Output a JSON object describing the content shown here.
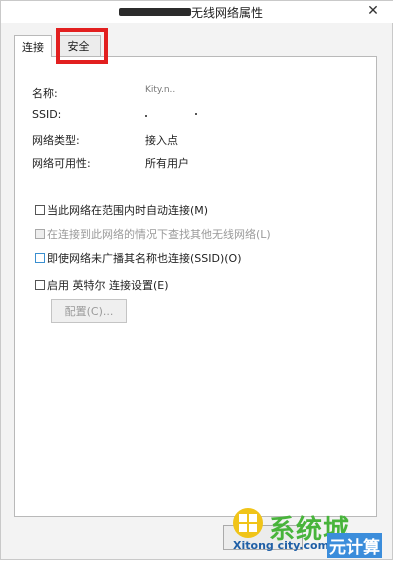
{
  "window": {
    "title": "无线网络属性",
    "close_icon": "close-icon"
  },
  "tabs": [
    {
      "label": "连接",
      "selected": true
    },
    {
      "label": "安全",
      "selected": false
    }
  ],
  "properties": [
    {
      "label": "名称:",
      "value": "Kity.n.."
    },
    {
      "label": "SSID:",
      "value": ""
    },
    {
      "label": "网络类型:",
      "value": "接入点"
    },
    {
      "label": "网络可用性:",
      "value": "所有用户"
    }
  ],
  "options": [
    {
      "label": "当此网络在范围内时自动连接(M)",
      "checked": false,
      "enabled": true
    },
    {
      "label": "在连接到此网络的情况下查找其他无线网络(L)",
      "checked": false,
      "enabled": false
    },
    {
      "label": "即使网络未广播其名称也连接(SSID)(O)",
      "checked": false,
      "enabled": true
    },
    {
      "label": "启用 英特尔 连接设置(E)",
      "checked": false,
      "enabled": true
    }
  ],
  "config_button": "配置(C)...",
  "watermark": {
    "main": "系统城",
    "sub": "Xitong city.com",
    "side": "元计算"
  },
  "colors": {
    "highlight": "#e21f1f",
    "watermark_green": "#48b43b",
    "watermark_blue": "#1f5fa6"
  }
}
